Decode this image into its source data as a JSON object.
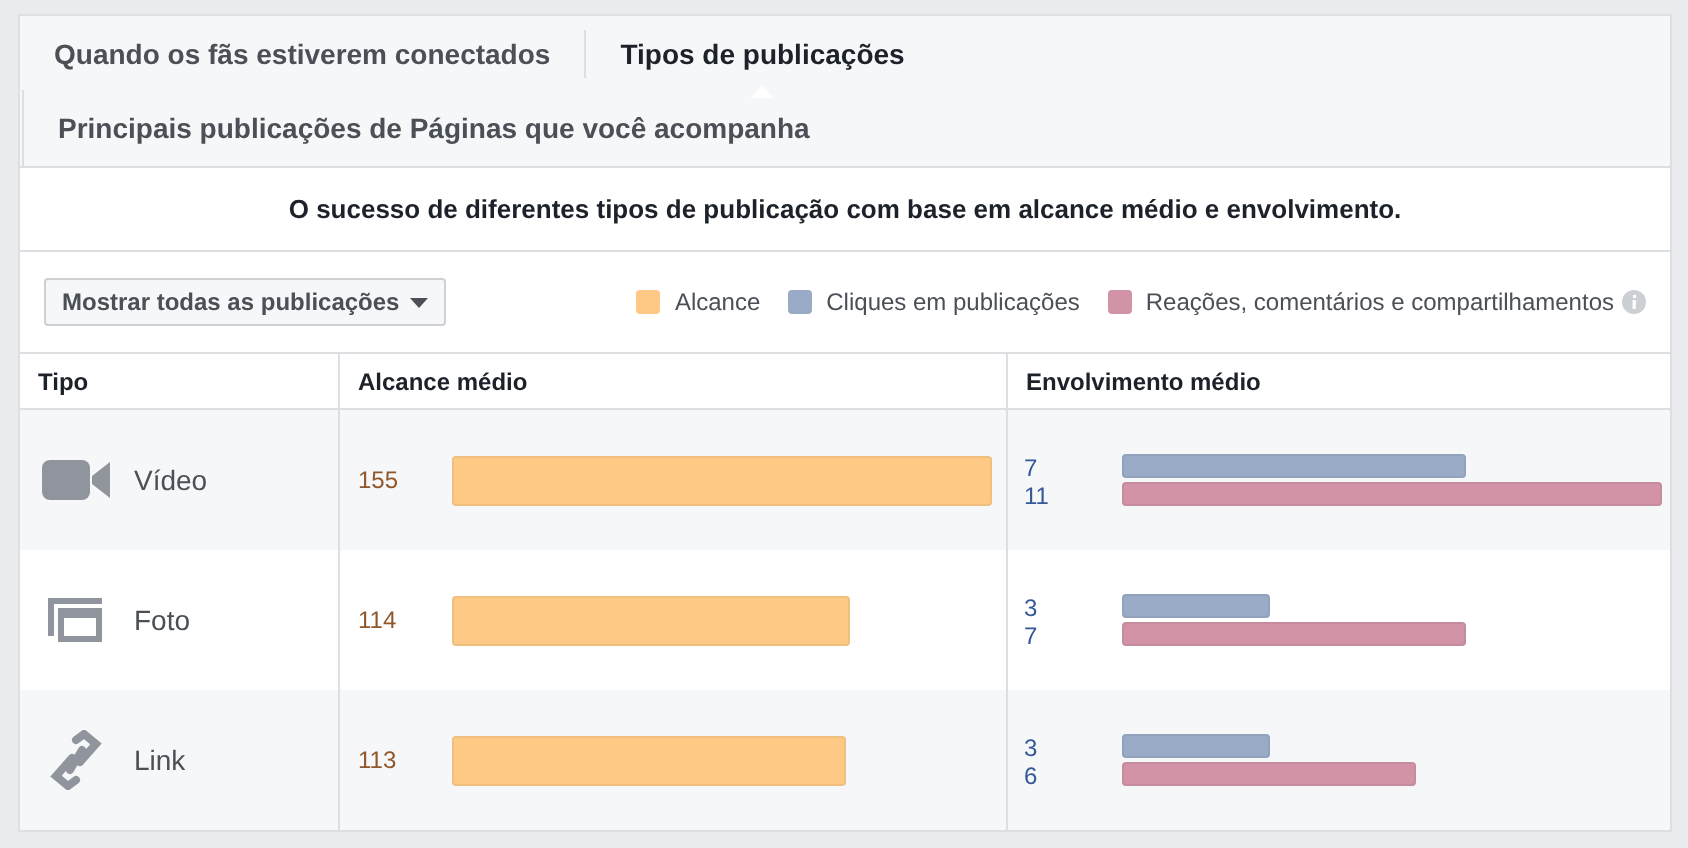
{
  "tabs": [
    {
      "label": "Quando os fãs estiverem conectados",
      "selected": false
    },
    {
      "label": "Tipos de publicações",
      "selected": true
    },
    {
      "label": "Principais publicações de Páginas que você acompanha",
      "selected": false
    }
  ],
  "description": "O sucesso de diferentes tipos de publicação com base em alcance médio e envolvimento.",
  "filter_button": "Mostrar todas as publicações",
  "legend": [
    {
      "label": "Alcance",
      "color": "#fdc985"
    },
    {
      "label": "Cliques em publicações",
      "color": "#9aabc8"
    },
    {
      "label": "Reações, comentários e compartilhamentos",
      "color": "#d293a7"
    }
  ],
  "table": {
    "columns": [
      "Tipo",
      "Alcance médio",
      "Envolvimento médio"
    ],
    "rows": [
      {
        "kind": "video",
        "type": "Vídeo",
        "reach": "155",
        "clicks": "7",
        "reactions": "11"
      },
      {
        "kind": "photo",
        "type": "Foto",
        "reach": "114",
        "clicks": "3",
        "reactions": "7"
      },
      {
        "kind": "link",
        "type": "Link",
        "reach": "113",
        "clicks": "3",
        "reactions": "6"
      }
    ]
  }
}
